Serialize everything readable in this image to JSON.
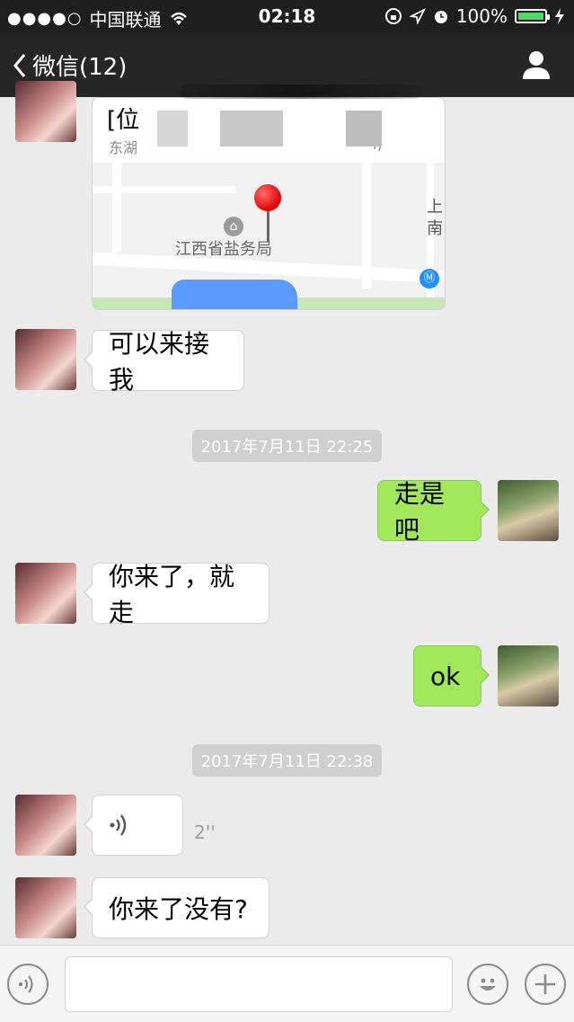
{
  "status_bar": {
    "signal_dots": "●●●●○",
    "carrier": "中国联通",
    "time": "02:18",
    "battery": "100%",
    "battery_color": "#4cd964"
  },
  "nav": {
    "back_label": "微信(12)"
  },
  "messages": {
    "location": {
      "title": "[位",
      "address_start": "东湖",
      "address_end": "i)",
      "map_label": "江西省盐务局",
      "map_side_text": "上\n南"
    },
    "m1": "可以来接我",
    "ts1": "2017年7月11日 22:25",
    "m2": "走是吧",
    "m3": "你来了，就走",
    "m4": "ok",
    "ts2": "2017年7月11日 22:38",
    "voice_duration": "2''",
    "m6": "你来了没有?"
  },
  "colors": {
    "outgoing_bubble": "#a0e75a",
    "incoming_bubble": "#ffffff",
    "nav_bg": "#262626",
    "background": "#ebebeb"
  },
  "icons": [
    "wifi-icon",
    "lock-rotation-icon",
    "location-arrow-icon",
    "alarm-icon",
    "charging-icon",
    "back-chevron-icon",
    "contact-profile-icon",
    "voice-icon",
    "emoji-icon",
    "plus-icon",
    "map-pin-icon",
    "government-building-icon",
    "metro-icon"
  ]
}
